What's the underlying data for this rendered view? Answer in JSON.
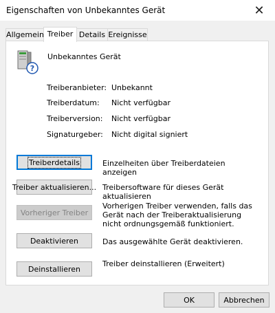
{
  "window": {
    "title": "Eigenschaften von Unbekanntes Gerät",
    "close_glyph": "✕"
  },
  "tabs": [
    {
      "label": "Allgemein"
    },
    {
      "label": "Treiber",
      "active": true
    },
    {
      "label": "Details"
    },
    {
      "label": "Ereignisse"
    }
  ],
  "device": {
    "name": "Unbekanntes Gerät",
    "icon": "unknown-device-icon"
  },
  "properties": [
    {
      "label": "Treiberanbieter:",
      "value": "Unbekannt"
    },
    {
      "label": "Treiberdatum:",
      "value": "Nicht verfügbar"
    },
    {
      "label": "Treiberversion:",
      "value": "Nicht verfügbar"
    },
    {
      "label": "Signaturgeber:",
      "value": "Nicht digital signiert"
    }
  ],
  "actions": [
    {
      "label": "Treiberdetails",
      "description": "Einzelheiten über Treiberdateien anzeigen"
    },
    {
      "label": "Treiber aktualisieren...",
      "description": "Treibersoftware für dieses Gerät aktualisieren"
    },
    {
      "label": "Vorheriger Treiber",
      "description": "Vorherigen Treiber verwenden, falls das Gerät nach der Treiberaktualisierung nicht ordnungsgemäß funktioniert.",
      "disabled": true
    },
    {
      "label": "Deaktivieren",
      "description": "Das ausgewählte Gerät deaktivieren."
    },
    {
      "label": "Deinstallieren",
      "description": "Treiber deinstallieren (Erweitert)"
    }
  ],
  "footer": {
    "ok_label": "OK",
    "cancel_label": "Abbrechen"
  },
  "colors": {
    "focus": "#0078d7",
    "dialog_bg": "#f0f0f0",
    "panel_bg": "#ffffff"
  }
}
